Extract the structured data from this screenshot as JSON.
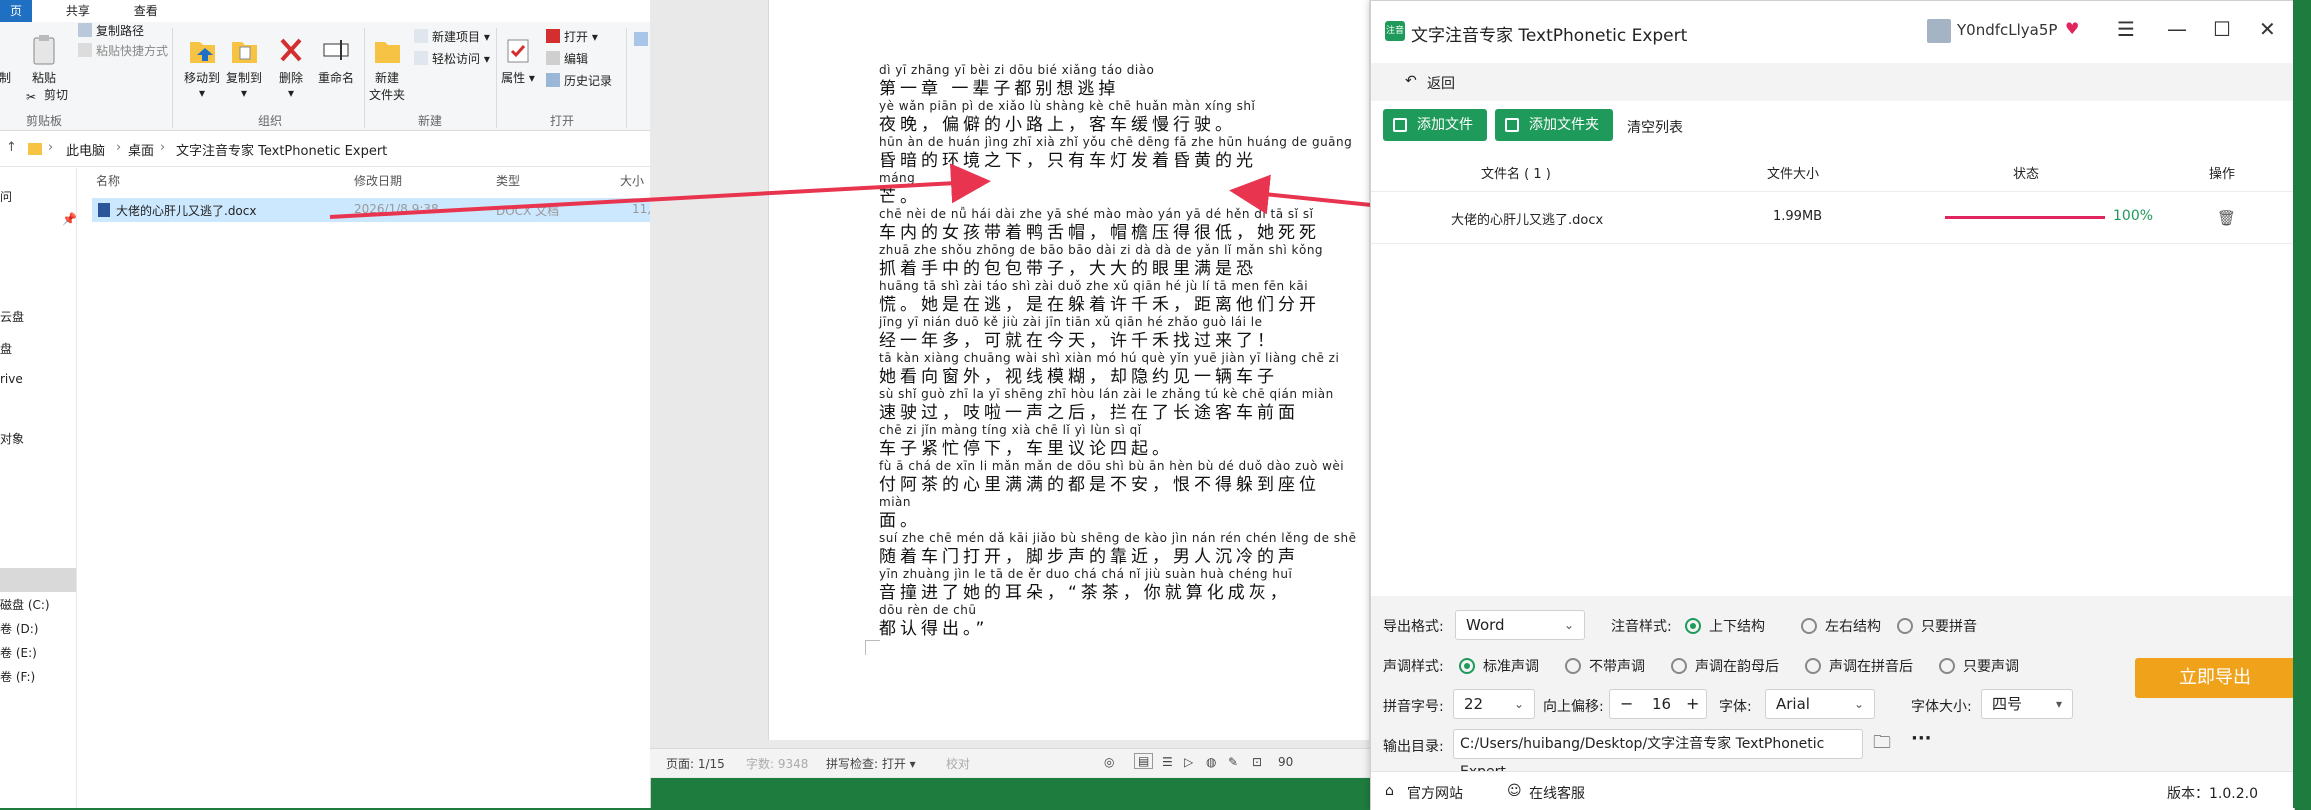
{
  "explorer": {
    "tabs": [
      "页",
      "共享",
      "查看"
    ],
    "ribbon": {
      "copy_path": "复制路径",
      "paste_shortcut": "粘贴快捷方式",
      "cut": "剪切",
      "pin_label": "制",
      "paste": "粘贴",
      "move_to": "移动到",
      "copy_to": "复制到",
      "delete": "删除",
      "rename": "重命名",
      "new_folder_1": "新建",
      "new_folder_2": "文件夹",
      "new_item": "新建项目 ▾",
      "easy_access": "轻松访问 ▾",
      "properties": "属性",
      "open": "打开 ▾",
      "edit": "编辑",
      "history": "历史记录",
      "group_clipboard": "剪贴板",
      "group_organize": "组织",
      "group_new": "新建",
      "group_open": "打开"
    },
    "address": [
      "此电脑",
      "桌面",
      "文字注音专家 TextPhonetic Expert"
    ],
    "nav_items": [
      "问",
      "云盘",
      "盘",
      "rive",
      "对象",
      "磁盘 (C:)",
      "卷 (D:)",
      "卷 (E:)",
      "卷 (F:)"
    ],
    "columns": [
      "名称",
      "修改日期",
      "类型",
      "大小"
    ],
    "file": {
      "name": "大佬的心肝儿又逃了.docx",
      "date": "2026/1/8 9:38",
      "type": "DOCX 文档",
      "size": "11,"
    }
  },
  "word": {
    "lines": [
      {
        "py": "dì  yī  zhāng    yī  bèi  zi   dōu  bié  xiǎng táo  diào",
        "hz": "第一章 一辈子都别想逃掉"
      },
      {
        "py": "yè  wǎn     piān  pì  de  xiǎo  lù  shàng      kè  chē  huǎn  màn  xíng  shǐ",
        "hz": "夜晚，偏僻的小路上，客车缓慢行驶。"
      },
      {
        "py": "hūn  àn  de  huán  jìng zhī  xià      zhǐ  yǒu  chē  dēng  fā  zhe  hūn  huáng  de  guāng",
        "hz": "昏暗的环境之下，只有车灯发着昏黄的光"
      },
      {
        "py": "máng",
        "hz": "芒。"
      },
      {
        "py": "chē  nèi  de  nǚ  hái  dài  zhe  yā  shé  mào      mào  yán  yā  dé  hěn  dī      tā  sǐ  sǐ",
        "hz": "车内的女孩带着鸭舌帽，帽檐压得很低，她死死"
      },
      {
        "py": "zhuā  zhe  shǒu  zhōng  de  bāo  bāo  dài  zi       dà  dà  de  yǎn  lǐ  mǎn  shì  kǒng",
        "hz": "抓着手中的包包带子，大大的眼里满是恐"
      },
      {
        "py": "huāng      tā  shì  zài  táo     shì  zài  duǒ  zhe  xǔ  qiān  hé       jù  lí  tā  men  fēn  kāi",
        "hz": "慌。她是在逃，是在躲着许千禾，距离他们分开"
      },
      {
        "py": "jīng  yī  nián  duō      kě  jiù  zài  jīn  tiān      xǔ  qiān  hé  zhǎo  guò  lái  le",
        "hz": "经一年多，可就在今天，许千禾找过来了！"
      },
      {
        "py": "tā  kàn  xiàng  chuāng  wài      shì  xiàn  mó  hú       què  yǐn  yuē  jiàn  yī  liàng  chē  zi",
        "hz": "她看向窗外，视线模糊，却隐约见一辆车子"
      },
      {
        "py": "sù  shǐ  guò      zhī  la  yī  shēng  zhī  hòu      lán  zài  le  zhǎng  tú  kè  chē  qián  miàn",
        "hz": "速驶过，吱啦一声之后，拦在了长途客车前面"
      },
      {
        "py": "chē  zi  jǐn  màng tíng  xià       chē  lǐ  yì  lùn  sì  qǐ",
        "hz": "车子紧忙停下，车里议论四起。"
      },
      {
        "py": "fù  ā  chá  de  xīn  li  mǎn  mǎn  de  dōu  shì  bù  ān      hèn  bù  dé  duǒ  dào  zuò  wèi",
        "hz": "付阿茶的心里满满的都是不安，恨不得躲到座位"
      },
      {
        "py": "miàn",
        "hz": "面。"
      },
      {
        "py": "suí  zhe  chē  mén  dǎ  kāi      jiǎo  bù  shēng  de  kào  jìn      nán  rén  chén  lěng  de  shē",
        "hz": "随着车门打开，脚步声的靠近，男人沉冷的声"
      },
      {
        "py": "yīn  zhuàng  jìn  le  tā  de  ěr  duo       chá  chá      nǐ  jiù  suàn  huà  chéng  huī",
        "hz": "音撞进了她的耳朵，“茶茶，你就算化成灰，"
      },
      {
        "py": "dōu  rèn  de  chū",
        "hz": "都认得出。”"
      }
    ],
    "status": {
      "page": "页面: 1/15",
      "words": "字数: 9348",
      "spell": "拼写检查: 打开 ▾",
      "proof": "校对",
      "zoom": "90"
    }
  },
  "app": {
    "title": "文字注音专家 TextPhonetic Expert",
    "logo_text": "注音",
    "user": "Y0ndfcLlya5P",
    "back": "返回",
    "add_file": "添加文件",
    "add_folder": "添加文件夹",
    "clear_list": "清空列表",
    "table_headers": {
      "name": "文件名 ( 1 )",
      "size": "文件大小",
      "status": "状态",
      "action": "操作"
    },
    "row": {
      "name": "大佬的心肝儿又逃了.docx",
      "size": "1.99MB",
      "progress": "100%",
      "progress_value": 1.0
    },
    "settings": {
      "export_format_label": "导出格式:",
      "export_format": "Word",
      "phonetic_style_label": "注音样式:",
      "phonetic_styles": [
        "上下结构",
        "左右结构",
        "只要拼音"
      ],
      "tone_style_label": "声调样式:",
      "tone_styles": [
        "标准声调",
        "不带声调",
        "声调在韵母后",
        "声调在拼音后",
        "只要声调"
      ],
      "pinyin_size_label": "拼音字号:",
      "pinyin_size": "22",
      "offset_label": "向上偏移:",
      "offset_value": "16",
      "font_label": "字体:",
      "font_value": "Arial",
      "font_size_label": "字体大小:",
      "font_size_value": "四号",
      "output_dir_label": "输出目录:",
      "output_dir": "C:/Users/huibang/Desktop/文字注音专家 TextPhonetic Expert",
      "export_button": "立即导出"
    },
    "footer": {
      "website": "官方网站",
      "service": "在线客服",
      "version": "版本：1.0.2.0"
    }
  },
  "colors": {
    "accent": "#1e9a5a",
    "progress": "#e0245e",
    "export": "#f0a21b",
    "arrow": "#e8344e"
  }
}
